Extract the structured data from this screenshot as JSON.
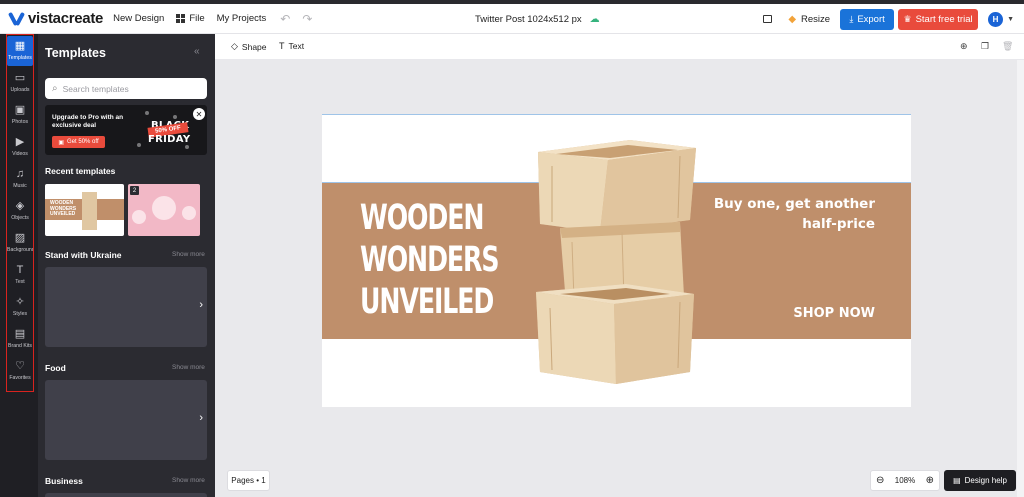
{
  "header": {
    "logo_text": "vistacreate",
    "new_design": "New Design",
    "file": "File",
    "my_projects": "My Projects",
    "undo_icon": "↶",
    "redo_icon": "↷",
    "document_title": "Twitter Post 1024x512 px",
    "resize": "Resize",
    "export": "Export",
    "start_trial": "Start free trial",
    "avatar_initial": "H"
  },
  "rail": {
    "items": [
      {
        "label": "Templates",
        "icon": "▦"
      },
      {
        "label": "Uploads",
        "icon": "▭"
      },
      {
        "label": "Photos",
        "icon": "▣"
      },
      {
        "label": "Videos",
        "icon": "▶"
      },
      {
        "label": "Music",
        "icon": "♫"
      },
      {
        "label": "Objects",
        "icon": "◈"
      },
      {
        "label": "Backgrounds",
        "icon": "▨"
      },
      {
        "label": "Text",
        "icon": "T"
      },
      {
        "label": "Styles",
        "icon": "✧"
      },
      {
        "label": "Brand Kits",
        "icon": "▤"
      },
      {
        "label": "Favorites",
        "icon": "♡"
      }
    ]
  },
  "panel": {
    "title": "Templates",
    "collapse_icon": "«",
    "search_placeholder": "Search templates",
    "promo": {
      "text": "Upgrade to Pro with an exclusive deal",
      "button": "Get 50% off",
      "badge_black": "BLACK",
      "badge_off": "50% OFF",
      "badge_friday": "FRIDAY"
    },
    "recent_title": "Recent templates",
    "thumb1_text": "WOODEN WONDERS UNVEILED",
    "thumb2_number": "2",
    "sections": [
      {
        "title": "Stand with Ukraine",
        "show_more": "Show more"
      },
      {
        "title": "Food",
        "show_more": "Show more"
      },
      {
        "title": "Business",
        "show_more": "Show more"
      }
    ],
    "chevron": "›"
  },
  "toolbar": {
    "shape": "Shape",
    "text": "Text"
  },
  "design": {
    "headline": [
      "WOODEN",
      "WONDERS",
      "UNVEILED"
    ],
    "offer": [
      "Buy one, get another",
      "half-price"
    ],
    "cta": "SHOP NOW",
    "colors": {
      "band": "#bf8f6b",
      "wood_light": "#ecd8b6",
      "wood_dark": "#cfa97c"
    }
  },
  "bottom": {
    "pages": "Pages • 1",
    "zoom": "108%",
    "design_help": "Design help"
  },
  "colors": {
    "accent": "#1a73d9",
    "trial": "#e94b3c",
    "rail_bg": "#1f1f24",
    "panel_bg": "#2b2b31",
    "highlight": "#d9231f"
  }
}
